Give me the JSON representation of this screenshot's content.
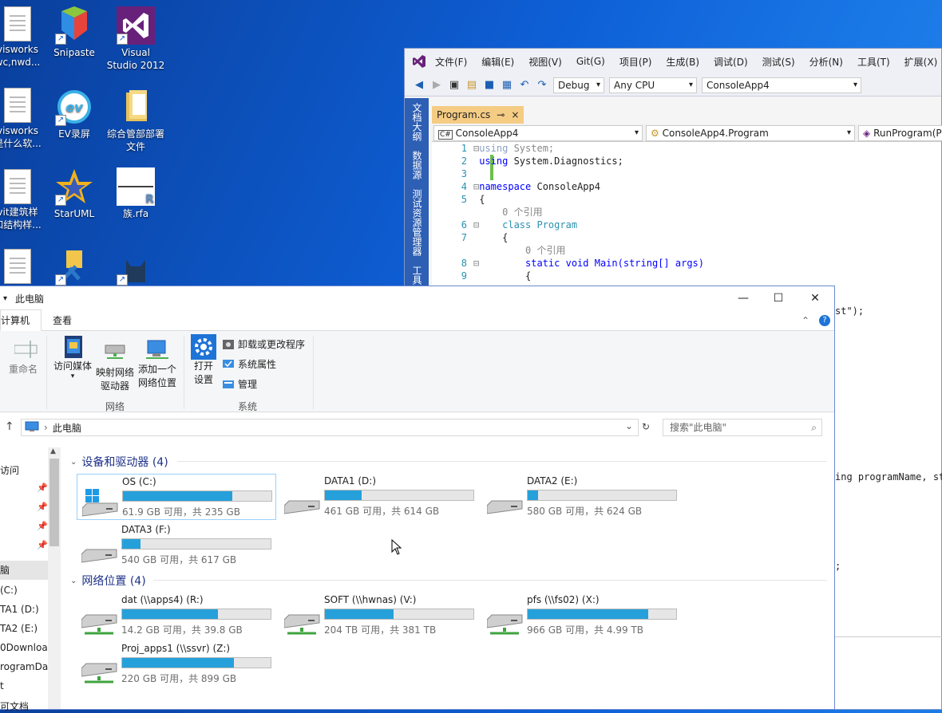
{
  "desktop": {
    "icons": [
      {
        "label": "visworks\nwc,nwd..."
      },
      {
        "label": "Snipaste"
      },
      {
        "label": "Visual\nStudio 2012"
      },
      {
        "label": "visworks\n是什么软..."
      },
      {
        "label": "EV录屏"
      },
      {
        "label": "综合管部部署\n文件"
      },
      {
        "label": "vit建筑样\n和结构样..."
      },
      {
        "label": "StarUML"
      },
      {
        "label": "族.rfa"
      }
    ]
  },
  "vs": {
    "menu": [
      "文件(F)",
      "编辑(E)",
      "视图(V)",
      "Git(G)",
      "项目(P)",
      "生成(B)",
      "调试(D)",
      "测试(S)",
      "分析(N)",
      "工具(T)",
      "扩展(X)"
    ],
    "config": "Debug",
    "platform": "Any CPU",
    "startup_project": "ConsoleApp4",
    "side_tabs": [
      "文档大纲",
      "数据源",
      "测试资源管理器",
      "工具"
    ],
    "doc_tab": "Program.cs",
    "doc_tab_pin": "⊸",
    "doc_tab_close": "×",
    "nav": [
      "ConsoleApp4",
      "ConsoleApp4.Program",
      "RunProgram(Pro"
    ],
    "code": [
      {
        "ln": "1",
        "pre": "⊟",
        "t1": "using",
        "t2": " System;"
      },
      {
        "ln": "2",
        "pre": " ",
        "t1": "using",
        "t2": " System.Diagnostics;"
      },
      {
        "ln": "3",
        "pre": " ",
        "t1": "",
        "t2": ""
      },
      {
        "ln": "4",
        "pre": "⊟",
        "t1": "namespace",
        "t2": " ConsoleApp4"
      },
      {
        "ln": "5",
        "pre": " ",
        "t1": "",
        "t2": "{"
      },
      {
        "ln": "",
        "pre": " ",
        "t1": "",
        "t2": "    0 个引用"
      },
      {
        "ln": "6",
        "pre": "⊟",
        "t1": "",
        "t2": "    class Program"
      },
      {
        "ln": "7",
        "pre": " ",
        "t1": "",
        "t2": "    {"
      },
      {
        "ln": "",
        "pre": " ",
        "t1": "",
        "t2": "        0 个引用"
      },
      {
        "ln": "8",
        "pre": "⊟",
        "t1": "",
        "t2": "        static void Main(string[] args)"
      },
      {
        "ln": "9",
        "pre": " ",
        "t1": "",
        "t2": "        {"
      }
    ],
    "frag1": "st\");",
    "frag2": "ing programName, str",
    "frag3": ";"
  },
  "explorer": {
    "title": "此电脑",
    "tabs": [
      "计算机",
      "查看"
    ],
    "ribbon": {
      "rename": "重命名",
      "access_media": "访问媒体",
      "map_drive": "映射网络\n驱动器",
      "add_location": "添加一个\n网络位置",
      "open_settings": "打开\n设置",
      "uninstall": "卸载或更改程序",
      "system_props": "系统属性",
      "manage": "管理",
      "group_network": "网络",
      "group_system": "系统"
    },
    "address": "此电脑",
    "search_placeholder": "搜索\"此电脑\"",
    "nav_items": [
      "访问",
      "",
      "",
      "",
      "",
      "脑",
      "(C:)",
      "TA1 (D:)",
      "TA2 (E:)",
      "0Download",
      "rogramData",
      "t",
      "可文档"
    ],
    "sections": {
      "devices": "设备和驱动器 (4)",
      "network": "网络位置 (4)"
    },
    "drives": [
      {
        "name": "OS (C:)",
        "info": "61.9 GB 可用，共 235 GB",
        "used": 0.737,
        "kind": "os"
      },
      {
        "name": "DATA1 (D:)",
        "info": "461 GB 可用，共 614 GB",
        "used": 0.249,
        "kind": "disk"
      },
      {
        "name": "DATA2 (E:)",
        "info": "580 GB 可用，共 624 GB",
        "used": 0.071,
        "kind": "disk"
      },
      {
        "name": "DATA3 (F:)",
        "info": "540 GB 可用，共 617 GB",
        "used": 0.125,
        "kind": "disk"
      }
    ],
    "network_drives": [
      {
        "name": "dat (\\\\apps4) (R:)",
        "info": "14.2 GB 可用，共 39.8 GB",
        "used": 0.643,
        "kind": "net"
      },
      {
        "name": "SOFT (\\\\hwnas) (V:)",
        "info": "204 TB 可用，共 381 TB",
        "used": 0.465,
        "kind": "net"
      },
      {
        "name": "pfs (\\\\fs02) (X:)",
        "info": "966 GB 可用，共 4.99 TB",
        "used": 0.811,
        "kind": "net"
      },
      {
        "name": "Proj_apps1 (\\\\ssvr) (Z:)",
        "info": "220 GB 可用，共 899 GB",
        "used": 0.755,
        "kind": "net"
      }
    ]
  }
}
